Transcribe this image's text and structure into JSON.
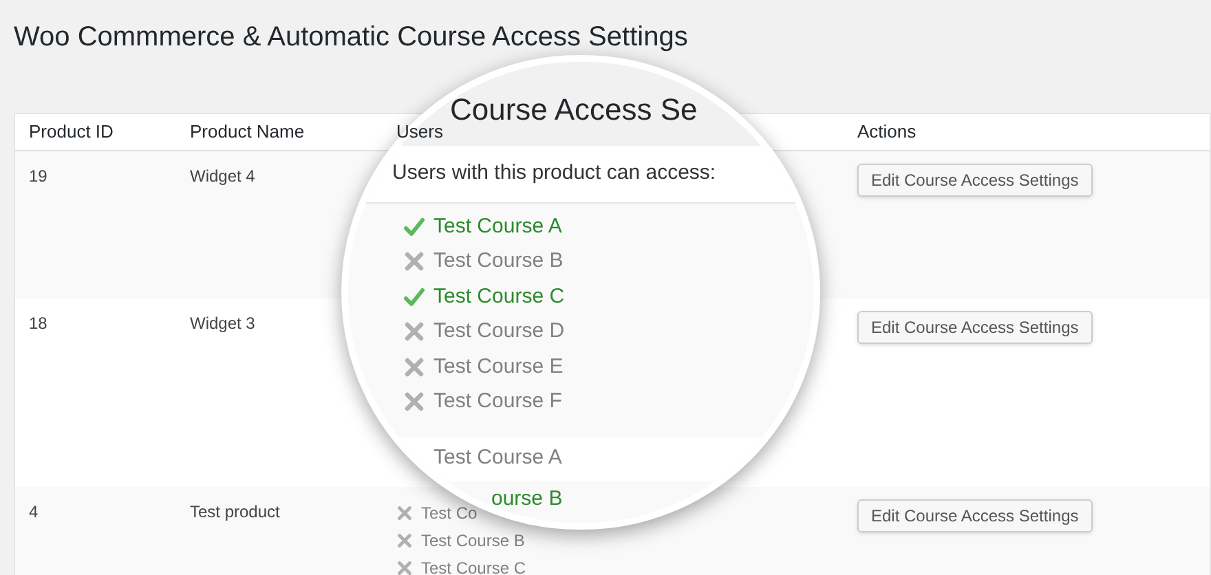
{
  "page_title": "Woo Commmerce & Automatic Course Access Settings",
  "table": {
    "columns": [
      "Product ID",
      "Product Name",
      "Users",
      "Actions"
    ],
    "rows": [
      {
        "product_id": "19",
        "product_name": "Widget 4",
        "courses": [],
        "action": "Edit Course Access Settings"
      },
      {
        "product_id": "18",
        "product_name": "Widget 3",
        "courses": [],
        "action": "Edit Course Access Settings"
      },
      {
        "product_id": "4",
        "product_name": "Test product",
        "courses": [
          {
            "name": "Test Co",
            "checked": false
          },
          {
            "name": "Test Course B",
            "checked": false
          },
          {
            "name": "Test Course C",
            "checked": false
          }
        ],
        "action": "Edit Course Access Settings"
      }
    ]
  },
  "magnifier": {
    "heading": "Course Access Se",
    "subheading": "Users with this product can access:",
    "courses": [
      {
        "name": "Test Course A",
        "checked": true
      },
      {
        "name": "Test Course B",
        "checked": false
      },
      {
        "name": "Test Course C",
        "checked": true
      },
      {
        "name": "Test Course D",
        "checked": false
      },
      {
        "name": "Test Course E",
        "checked": false
      },
      {
        "name": "Test Course F",
        "checked": false
      }
    ],
    "next_courses": [
      {
        "name": "Test Course A",
        "checked": false
      },
      {
        "name": "ourse B",
        "checked": true
      }
    ]
  }
}
